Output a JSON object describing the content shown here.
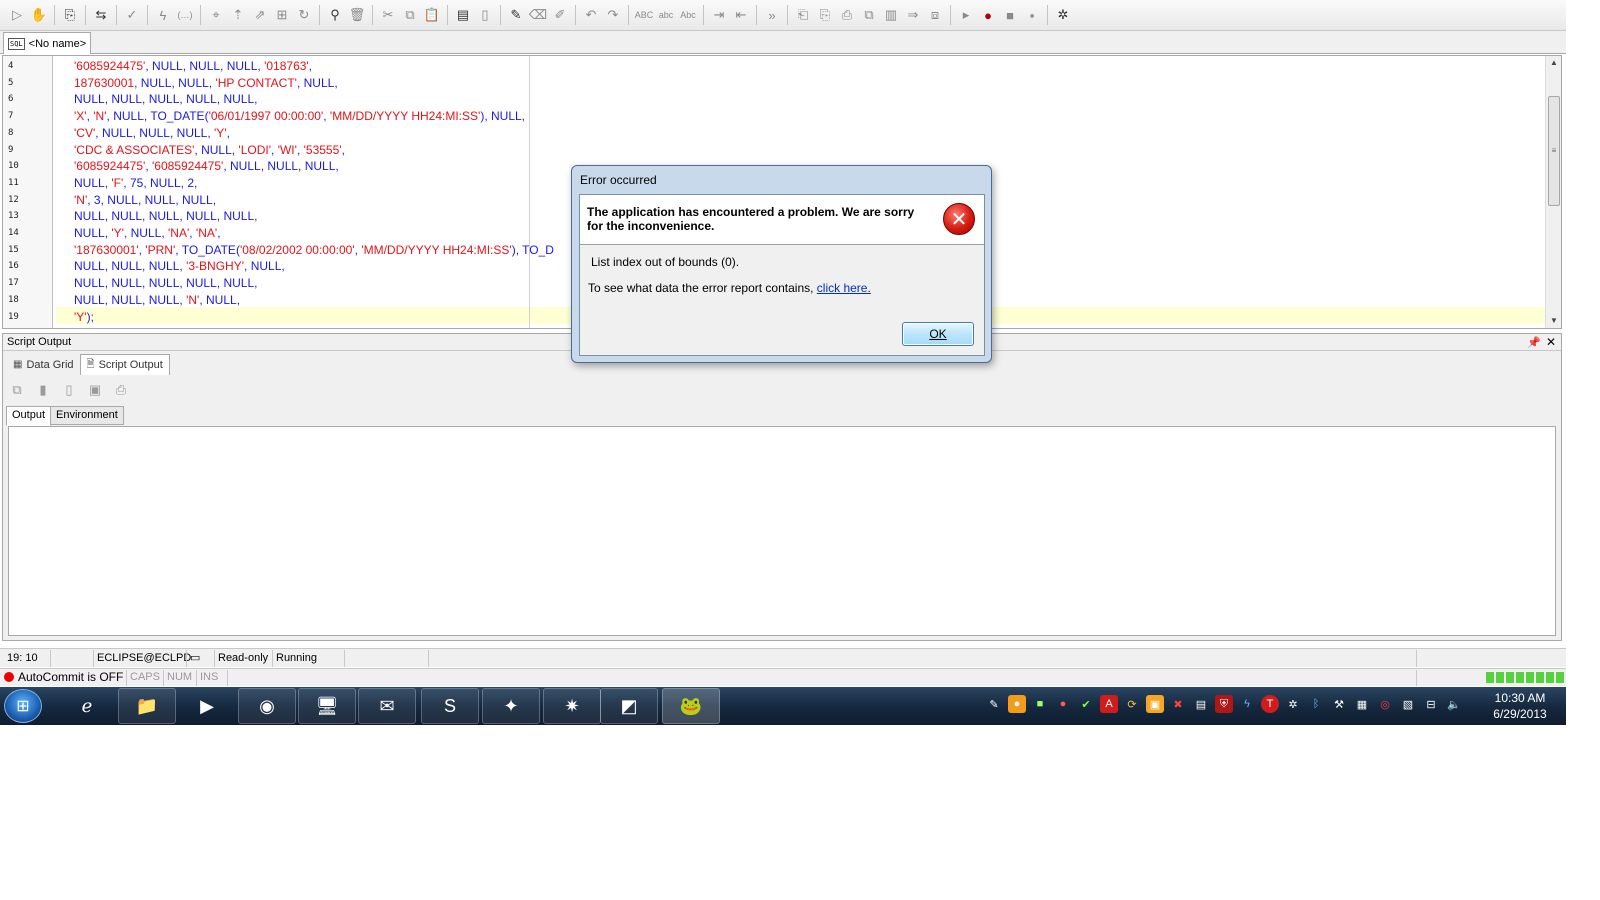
{
  "toolbar": {
    "groups": [
      [
        "run-pointer-icon",
        "hand-icon"
      ],
      [
        "bookmark-icon"
      ],
      [
        "connection-icon"
      ],
      [
        "commit-icon"
      ],
      [
        "lightning-icon",
        "ellipsis-icon"
      ],
      [
        "cursor-icon",
        "cursor-up-icon",
        "cursor-jump-icon",
        "format-icon",
        "refresh-icon"
      ],
      [
        "binoculars-icon",
        "trash-icon"
      ],
      [
        "cut-icon",
        "copy-icon",
        "paste-icon"
      ],
      [
        "table-icon",
        "page-icon"
      ],
      [
        "highlight-icon",
        "clear-icon",
        "erase-icon"
      ],
      [
        "undo-icon",
        "redo-icon"
      ],
      [
        "abc-icon",
        "abc-lower-icon",
        "abc-spell-icon"
      ],
      [
        "indent-icon",
        "outdent-icon"
      ],
      [
        "forward-icon"
      ],
      [
        "doc-1-icon",
        "doc-2-icon",
        "doc-3-icon",
        "doc-4-icon",
        "doc-5-icon",
        "doc-6-icon",
        "doc-7-icon"
      ],
      [
        "play-icon",
        "record-icon",
        "stop-icon",
        "square-icon"
      ],
      [
        "debug-icon"
      ]
    ]
  },
  "editor_tab": {
    "label": "<No name>",
    "icon": "sql-icon"
  },
  "editor": {
    "lines": [
      {
        "n": "4",
        "tokens": [
          [
            "s",
            "'6085924475'"
          ],
          [
            "p",
            ", "
          ],
          [
            "k",
            "NULL"
          ],
          [
            "p",
            ", "
          ],
          [
            "k",
            "NULL"
          ],
          [
            "p",
            ", "
          ],
          [
            "k",
            "NULL"
          ],
          [
            "p",
            ", "
          ],
          [
            "s",
            "'018763'"
          ],
          [
            "p",
            ","
          ]
        ]
      },
      {
        "n": "5",
        "tokens": [
          [
            "s",
            "187630001"
          ],
          [
            "p",
            ", "
          ],
          [
            "k",
            "NULL"
          ],
          [
            "p",
            ", "
          ],
          [
            "k",
            "NULL"
          ],
          [
            "p",
            ", "
          ],
          [
            "s",
            "'HP CONTACT'"
          ],
          [
            "p",
            ", "
          ],
          [
            "k",
            "NULL"
          ],
          [
            "p",
            ","
          ]
        ]
      },
      {
        "n": "6",
        "tokens": [
          [
            "k",
            "NULL"
          ],
          [
            "p",
            ", "
          ],
          [
            "k",
            "NULL"
          ],
          [
            "p",
            ", "
          ],
          [
            "k",
            "NULL"
          ],
          [
            "p",
            ", "
          ],
          [
            "k",
            "NULL"
          ],
          [
            "p",
            ", "
          ],
          [
            "k",
            "NULL"
          ],
          [
            "p",
            ","
          ]
        ]
      },
      {
        "n": "7",
        "tokens": [
          [
            "s",
            "'X'"
          ],
          [
            "p",
            ", "
          ],
          [
            "s",
            "'N'"
          ],
          [
            "p",
            ", "
          ],
          [
            "k",
            "NULL"
          ],
          [
            "p",
            ", "
          ],
          [
            "k",
            "TO_DATE("
          ],
          [
            "s",
            "'06/01/1997 00:00:00'"
          ],
          [
            "p",
            ", "
          ],
          [
            "s",
            "'MM/DD/YYYY HH24:MI:SS'"
          ],
          [
            "k",
            "), NULL,"
          ]
        ]
      },
      {
        "n": "8",
        "tokens": [
          [
            "s",
            "'CV'"
          ],
          [
            "p",
            ", "
          ],
          [
            "k",
            "NULL"
          ],
          [
            "p",
            ", "
          ],
          [
            "k",
            "NULL"
          ],
          [
            "p",
            ", "
          ],
          [
            "k",
            "NULL"
          ],
          [
            "p",
            ", "
          ],
          [
            "s",
            "'Y'"
          ],
          [
            "p",
            ","
          ]
        ]
      },
      {
        "n": "9",
        "tokens": [
          [
            "s",
            "'CDC & ASSOCIATES'"
          ],
          [
            "p",
            ", "
          ],
          [
            "k",
            "NULL"
          ],
          [
            "p",
            ", "
          ],
          [
            "s",
            "'LODI'"
          ],
          [
            "p",
            ", "
          ],
          [
            "s",
            "'WI'"
          ],
          [
            "p",
            ", "
          ],
          [
            "s",
            "'53555'"
          ],
          [
            "p",
            ","
          ]
        ]
      },
      {
        "n": "10",
        "tokens": [
          [
            "s",
            "'6085924475'"
          ],
          [
            "p",
            ", "
          ],
          [
            "s",
            "'6085924475'"
          ],
          [
            "p",
            ", "
          ],
          [
            "k",
            "NULL"
          ],
          [
            "p",
            ", "
          ],
          [
            "k",
            "NULL"
          ],
          [
            "p",
            ", "
          ],
          [
            "k",
            "NULL"
          ],
          [
            "p",
            ","
          ]
        ]
      },
      {
        "n": "11",
        "tokens": [
          [
            "k",
            "NULL"
          ],
          [
            "p",
            ", "
          ],
          [
            "s",
            "'F'"
          ],
          [
            "p",
            ", "
          ],
          [
            "k",
            "75"
          ],
          [
            "p",
            ", "
          ],
          [
            "k",
            "NULL"
          ],
          [
            "p",
            ", "
          ],
          [
            "k",
            "2"
          ],
          [
            "p",
            ","
          ]
        ]
      },
      {
        "n": "12",
        "tokens": [
          [
            "s",
            "'N'"
          ],
          [
            "p",
            ", "
          ],
          [
            "k",
            "3"
          ],
          [
            "p",
            ", "
          ],
          [
            "k",
            "NULL"
          ],
          [
            "p",
            ", "
          ],
          [
            "k",
            "NULL"
          ],
          [
            "p",
            ", "
          ],
          [
            "k",
            "NULL"
          ],
          [
            "p",
            ","
          ]
        ]
      },
      {
        "n": "13",
        "tokens": [
          [
            "k",
            "NULL"
          ],
          [
            "p",
            ", "
          ],
          [
            "k",
            "NULL"
          ],
          [
            "p",
            ", "
          ],
          [
            "k",
            "NULL"
          ],
          [
            "p",
            ", "
          ],
          [
            "k",
            "NULL"
          ],
          [
            "p",
            ", "
          ],
          [
            "k",
            "NULL"
          ],
          [
            "p",
            ","
          ]
        ]
      },
      {
        "n": "14",
        "tokens": [
          [
            "k",
            "NULL"
          ],
          [
            "p",
            ", "
          ],
          [
            "s",
            "'Y'"
          ],
          [
            "p",
            ", "
          ],
          [
            "k",
            "NULL"
          ],
          [
            "p",
            ", "
          ],
          [
            "s",
            "'NA'"
          ],
          [
            "p",
            ", "
          ],
          [
            "s",
            "'NA'"
          ],
          [
            "p",
            ","
          ]
        ]
      },
      {
        "n": "15",
        "tokens": [
          [
            "s",
            "'187630001'"
          ],
          [
            "p",
            ", "
          ],
          [
            "s",
            "'PRN'"
          ],
          [
            "p",
            ", "
          ],
          [
            "k",
            "TO_DATE("
          ],
          [
            "s",
            "'08/02/2002 00:00:00'"
          ],
          [
            "p",
            ", "
          ],
          [
            "s",
            "'MM/DD/YYYY HH24:MI:SS'"
          ],
          [
            "k",
            "), TO_D"
          ]
        ]
      },
      {
        "n": "16",
        "tokens": [
          [
            "k",
            "NULL"
          ],
          [
            "p",
            ", "
          ],
          [
            "k",
            "NULL"
          ],
          [
            "p",
            ", "
          ],
          [
            "k",
            "NULL"
          ],
          [
            "p",
            ", "
          ],
          [
            "s",
            "'3-BNGHY'"
          ],
          [
            "p",
            ", "
          ],
          [
            "k",
            "NULL"
          ],
          [
            "p",
            ","
          ]
        ]
      },
      {
        "n": "17",
        "tokens": [
          [
            "k",
            "NULL"
          ],
          [
            "p",
            ", "
          ],
          [
            "k",
            "NULL"
          ],
          [
            "p",
            ", "
          ],
          [
            "k",
            "NULL"
          ],
          [
            "p",
            ", "
          ],
          [
            "k",
            "NULL"
          ],
          [
            "p",
            ", "
          ],
          [
            "k",
            "NULL"
          ],
          [
            "p",
            ","
          ]
        ]
      },
      {
        "n": "18",
        "tokens": [
          [
            "k",
            "NULL"
          ],
          [
            "p",
            ", "
          ],
          [
            "k",
            "NULL"
          ],
          [
            "p",
            ", "
          ],
          [
            "k",
            "NULL"
          ],
          [
            "p",
            ", "
          ],
          [
            "s",
            "'N'"
          ],
          [
            "p",
            ", "
          ],
          [
            "k",
            "NULL"
          ],
          [
            "p",
            ","
          ]
        ]
      },
      {
        "n": "19",
        "tokens": [
          [
            "s",
            "'Y'"
          ],
          [
            "k",
            ");"
          ]
        ]
      }
    ]
  },
  "output_panel": {
    "title": "Script Output",
    "tabs": [
      {
        "label": "Data Grid",
        "icon": "grid-icon"
      },
      {
        "label": "Script Output",
        "icon": "script-icon"
      }
    ],
    "inner_tabs": [
      "Output",
      "Environment"
    ]
  },
  "statusbar": {
    "position": "19:  10",
    "connection": "ECLIPSE@ECLPD",
    "mode": "Read-only",
    "state": "Running"
  },
  "bottom_bar": {
    "autocommit": "AutoCommit is OFF",
    "caps": "CAPS",
    "num": "NUM",
    "ins": "INS"
  },
  "dialog": {
    "title": "Error occurred",
    "headline": "The application has encountered a problem. We are sorry for the inconvenience.",
    "message": "List index out of bounds (0).",
    "detail_prefix": "To see what data the error report contains, ",
    "detail_link": "click here.",
    "ok_label": "OK"
  },
  "taskbar": {
    "apps": [
      "ie-icon",
      "explorer-icon",
      "media-player-icon",
      "chrome-icon",
      "remote-desktop-icon",
      "outlook-icon",
      "skype-icon",
      "star-app-icon",
      "star-app-2-icon",
      "notepad-icon",
      "toad-icon"
    ],
    "clock_time": "10:30 AM",
    "clock_date": "6/29/2013"
  },
  "colors": {
    "string": "#e2141b",
    "keyword": "#1a1ae0",
    "current_line": "#ffffd4"
  }
}
